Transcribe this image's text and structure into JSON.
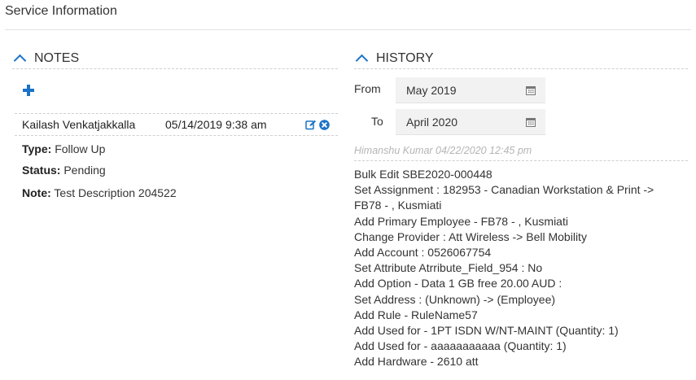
{
  "page": {
    "title": "Service Information"
  },
  "notes": {
    "heading": "NOTES",
    "add_label": "+",
    "entry": {
      "author": "Kailash Venkatjakkalla",
      "datetime": "05/14/2019 9:38 am",
      "type_label": "Type:",
      "type_value": "Follow Up",
      "status_label": "Status:",
      "status_value": "Pending",
      "note_label": "Note:",
      "note_value": "Test Description 204522"
    }
  },
  "history": {
    "heading": "HISTORY",
    "from_label": "From",
    "from_value": "May 2019",
    "to_label": "To",
    "to_value": "April 2020",
    "meta": "Himanshu Kumar 04/22/2020 12:45 pm",
    "lines": [
      "Bulk Edit SBE2020-000448",
      "Set Assignment : 182953 - Canadian Workstation & Print ->",
      "FB78 - , Kusmiati",
      "Add Primary Employee - FB78 - , Kusmiati",
      "Change Provider : Att Wireless -> Bell Mobility",
      "Add Account : 0526067754",
      "Set Attribute Atrribute_Field_954 : No",
      "Add Option - Data 1 GB free 20.00 AUD :",
      "Set Address : (Unknown) -> (Employee)",
      "Add Rule - RuleName57",
      "Add Used for - 1PT ISDN W/NT-MAINT (Quantity: 1)",
      "Add Used for - aaaaaaaaaaa (Quantity: 1)",
      "Add Hardware - 2610 att"
    ]
  },
  "icons": {
    "collapse": "chevron-up-icon",
    "add": "plus-icon",
    "edit": "edit-icon",
    "remove": "close-circle-icon",
    "calendar": "calendar-icon"
  },
  "colors": {
    "accent": "#1a73c8",
    "input_bg": "#f2f2f2",
    "muted": "#b5b5b5"
  }
}
